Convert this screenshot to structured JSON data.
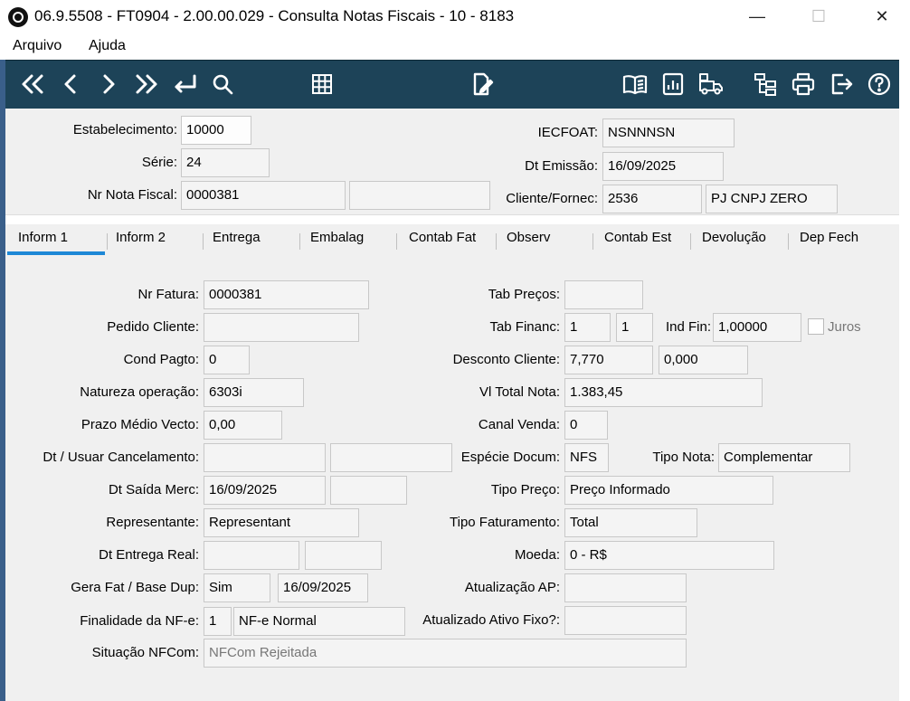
{
  "window": {
    "title": "06.9.5508 - FT0904 - 2.00.00.029 - Consulta Notas Fiscais - 10 - 8183",
    "min_glyph": "—",
    "max_glyph": "☐",
    "close_glyph": "✕"
  },
  "menu": [
    "Arquivo",
    "Ajuda"
  ],
  "toolbar": {
    "left": [
      "first-icon",
      "prev-icon",
      "next-icon",
      "last-icon",
      "goto-icon",
      "search-icon"
    ],
    "center": [
      "grid-icon",
      "edit-doc-icon"
    ],
    "right": [
      "book-icon",
      "report-icon",
      "truck-icon",
      "tree-icon",
      "print-icon",
      "exit-icon",
      "help-icon"
    ],
    "color": "#1d4358"
  },
  "header": {
    "estabelecimento": {
      "label": "Estabelecimento:",
      "value": "10000"
    },
    "serie": {
      "label": "Série:",
      "value": "24"
    },
    "nr_nota": {
      "label": "Nr Nota Fiscal:",
      "value": "0000381",
      "extra": ""
    },
    "iecfoat": {
      "label": "IECFOAT:",
      "value": "NSNNNSN"
    },
    "dt_emissao": {
      "label": "Dt Emissão:",
      "value": "16/09/2025"
    },
    "cliente": {
      "label": "Cliente/Fornec:",
      "code": "2536",
      "name": "PJ CNPJ ZERO"
    }
  },
  "tabs": [
    "Inform 1",
    "Inform 2",
    "Entrega",
    "Embalag",
    "Contab Fat",
    "Observ",
    "Contab Est",
    "Devolução",
    "Dep Fech"
  ],
  "active_tab": "Inform 1",
  "left_fields": {
    "nr_fatura": {
      "label": "Nr Fatura:",
      "value": "0000381"
    },
    "pedido_cliente": {
      "label": "Pedido Cliente:",
      "value": ""
    },
    "cond_pagto": {
      "label": "Cond Pagto:",
      "value": "0"
    },
    "natureza": {
      "label": "Natureza operação:",
      "value": "6303i"
    },
    "prazo": {
      "label": "Prazo Médio Vecto:",
      "value": "0,00"
    },
    "dt_cancel": {
      "label": "Dt / Usuar Cancelamento:",
      "value1": "",
      "value2": ""
    },
    "dt_saida": {
      "label": "Dt Saída Merc:",
      "value1": "16/09/2025",
      "value2": ""
    },
    "representante": {
      "label": "Representante:",
      "value": "Representant"
    },
    "dt_entrega": {
      "label": "Dt Entrega Real:",
      "value1": "",
      "value2": ""
    },
    "gera_fat": {
      "label": "Gera Fat / Base Dup:",
      "value1": "Sim",
      "value2": "16/09/2025"
    },
    "finalidade": {
      "label": "Finalidade da NF-e:",
      "code": "1",
      "desc": "NF-e Normal"
    },
    "situacao": {
      "label": "Situação NFCom:",
      "value": "NFCom Rejeitada"
    }
  },
  "right_fields": {
    "tab_precos": {
      "label": "Tab Preços:",
      "value": ""
    },
    "tab_financ": {
      "label": "Tab Financ:",
      "value1": "1",
      "value2": "1"
    },
    "ind_fin": {
      "label": "Ind Fin:",
      "value": "1,00000"
    },
    "juros": {
      "label": "Juros",
      "checked": false
    },
    "desconto": {
      "label": "Desconto Cliente:",
      "value1": "7,770",
      "value2": "0,000"
    },
    "vl_total": {
      "label": "Vl Total Nota:",
      "value": "1.383,45"
    },
    "canal_venda": {
      "label": "Canal Venda:",
      "value": "0"
    },
    "especie": {
      "label": "Espécie Docum:",
      "value": "NFS"
    },
    "tipo_nota": {
      "label": "Tipo Nota:",
      "value": "Complementar"
    },
    "tipo_preco": {
      "label": "Tipo Preço:",
      "value": "Preço Informado"
    },
    "tipo_fat": {
      "label": "Tipo Faturamento:",
      "value": "Total"
    },
    "moeda": {
      "label": "Moeda:",
      "value": "0 - R$"
    },
    "atualizacao_ap": {
      "label": "Atualização AP:",
      "value": ""
    },
    "ativo_fixo": {
      "label": "Atualizado Ativo Fixo?:",
      "value": ""
    }
  }
}
